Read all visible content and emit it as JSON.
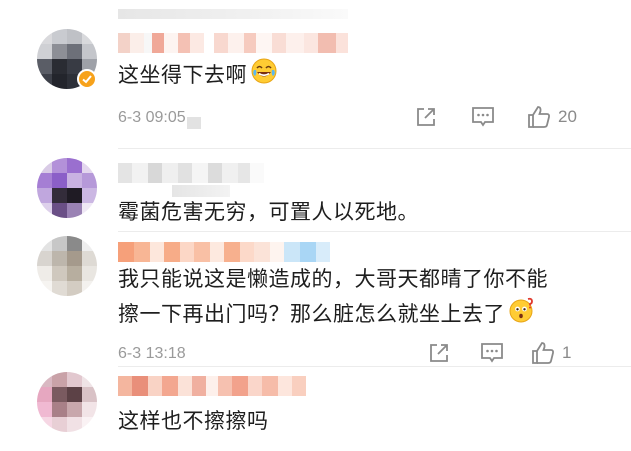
{
  "comments": [
    {
      "text": "这坐得下去啊",
      "time": "6-3 09:05",
      "likes": "20",
      "verified": true
    },
    {
      "text": "霉菌危害无穷，可置人以死地。"
    },
    {
      "text_line1": "我只能说这是懒造成的，大哥天都晴了你不能",
      "text_line2": "擦一下再出门吗？那么脏怎么就坐上去了",
      "time": "6-3 13:18",
      "likes": "1"
    },
    {
      "text": "这样也不擦擦吗"
    }
  ],
  "icons": {
    "share": "share-icon",
    "comment": "comment-icon",
    "like": "like-icon",
    "laugh_emoji": "laugh-cry-emoji",
    "thinking_emoji": "wonder-emoji",
    "verified": "verified-badge-icon"
  },
  "colors": {
    "text": "#1e1e1e",
    "meta": "#9a9a9a",
    "icon": "#8a8a8a",
    "badge": "#f7a21b"
  }
}
